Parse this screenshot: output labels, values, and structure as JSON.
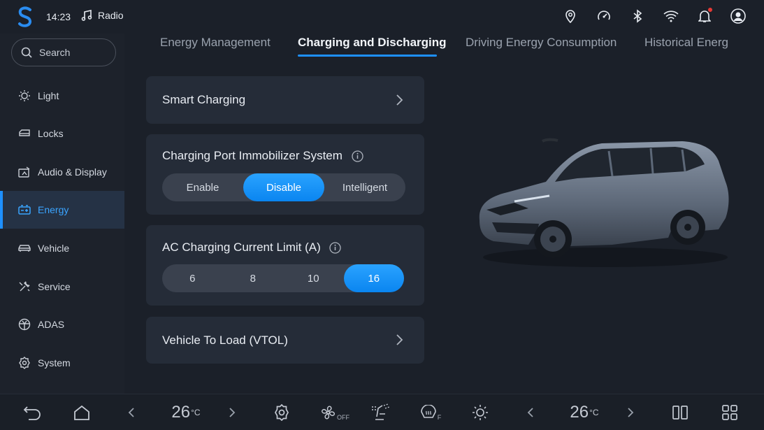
{
  "status": {
    "time": "14:23",
    "media_label": "Radio",
    "icons": [
      "location-icon",
      "speedometer-icon",
      "bluetooth-icon",
      "wifi-icon",
      "bell-icon",
      "profile-icon"
    ]
  },
  "sidebar": {
    "search_label": "Search",
    "items": [
      {
        "label": "Light",
        "icon": "light-icon"
      },
      {
        "label": "Locks",
        "icon": "lock-icon"
      },
      {
        "label": "Audio & Display",
        "icon": "audio-display-icon"
      },
      {
        "label": "Energy",
        "icon": "battery-icon",
        "active": true
      },
      {
        "label": "Vehicle",
        "icon": "car-icon"
      },
      {
        "label": "Service",
        "icon": "wrench-icon"
      },
      {
        "label": "ADAS",
        "icon": "steering-wheel-icon"
      },
      {
        "label": "System",
        "icon": "gear-icon"
      }
    ]
  },
  "tabs": [
    {
      "label": "Energy Management"
    },
    {
      "label": "Charging and Discharging",
      "active": true
    },
    {
      "label": "Driving Energy Consumption"
    },
    {
      "label": "Historical Energ"
    }
  ],
  "cards": {
    "smart_charging": "Smart Charging",
    "immobilizer": {
      "title": "Charging Port Immobilizer System",
      "options": [
        "Enable",
        "Disable",
        "Intelligent"
      ],
      "selected": "Disable"
    },
    "ac_limit": {
      "title": "AC Charging Current Limit (A)",
      "options": [
        "6",
        "8",
        "10",
        "16"
      ],
      "selected": "16"
    },
    "vtol": "Vehicle To Load (VTOL)"
  },
  "bottom": {
    "left_temp": "26",
    "right_temp": "26",
    "temp_unit": "°C",
    "fan_label": "OFF",
    "defrost_label": "F"
  },
  "colors": {
    "accent": "#1e90ff",
    "background": "#1b2029",
    "card": "#252c38"
  }
}
